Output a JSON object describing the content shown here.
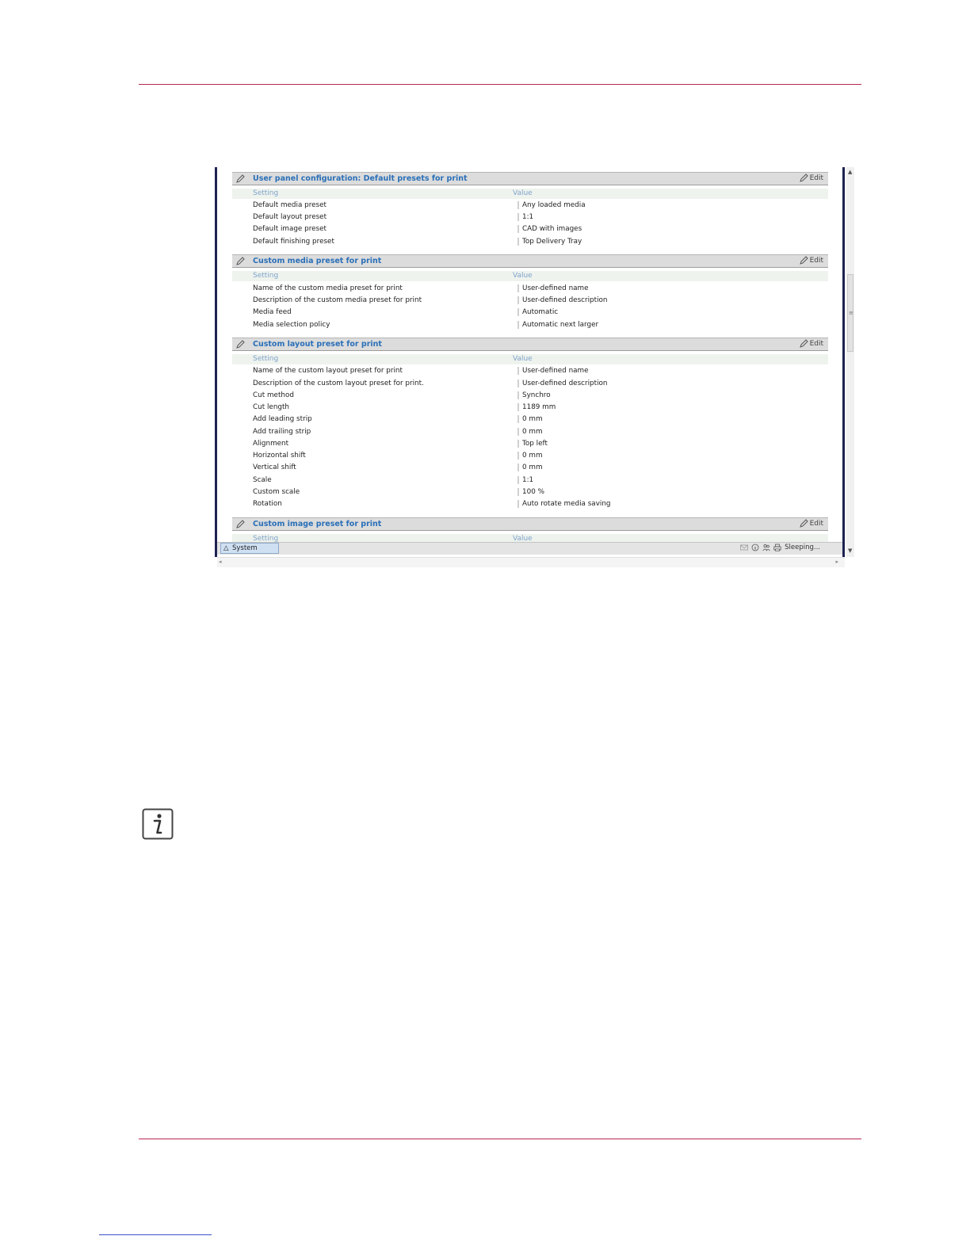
{
  "ui": {
    "edit_label": "Edit",
    "col_setting": "Setting",
    "col_value": "Value",
    "status_tab": "System",
    "status_text": "Sleeping..."
  },
  "sections": [
    {
      "title": "User panel configuration: Default presets for print",
      "rows": [
        {
          "setting": "Default media preset",
          "value": "Any loaded media"
        },
        {
          "setting": "Default layout preset",
          "value": "1:1"
        },
        {
          "setting": "Default image preset",
          "value": "CAD with images"
        },
        {
          "setting": "Default finishing preset",
          "value": "Top Delivery Tray"
        }
      ]
    },
    {
      "title": "Custom media preset for print",
      "rows": [
        {
          "setting": "Name of the custom media preset for print",
          "value": "User-defined name"
        },
        {
          "setting": "Description of the custom media preset for print",
          "value": "User-defined description"
        },
        {
          "setting": "Media feed",
          "value": "Automatic"
        },
        {
          "setting": "Media selection policy",
          "value": "Automatic next larger"
        }
      ]
    },
    {
      "title": "Custom layout preset for print",
      "rows": [
        {
          "setting": "Name of the custom layout preset for print",
          "value": "User-defined name"
        },
        {
          "setting": "Description of the custom layout preset for print.",
          "value": "User-defined description"
        },
        {
          "setting": "Cut method",
          "value": "Synchro"
        },
        {
          "setting": "Cut length",
          "value": "1189 mm"
        },
        {
          "setting": "Add leading strip",
          "value": "0 mm"
        },
        {
          "setting": "Add trailing strip",
          "value": "0 mm"
        },
        {
          "setting": "Alignment",
          "value": "Top left"
        },
        {
          "setting": "Horizontal shift",
          "value": "0 mm"
        },
        {
          "setting": "Vertical shift",
          "value": "0 mm"
        },
        {
          "setting": "Scale",
          "value": "1:1"
        },
        {
          "setting": "Custom scale",
          "value": "100 %"
        },
        {
          "setting": "Rotation",
          "value": "Auto rotate media saving"
        }
      ]
    },
    {
      "title": "Custom image preset for print",
      "rows": []
    }
  ]
}
